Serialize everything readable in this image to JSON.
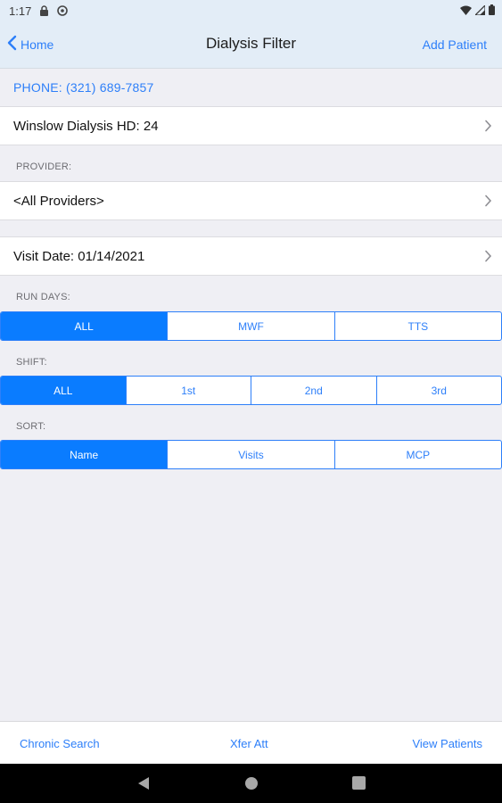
{
  "status": {
    "time": "1:17"
  },
  "nav": {
    "back_label": "Home",
    "title": "Dialysis Filter",
    "add_label": "Add Patient"
  },
  "phone": "PHONE: (321) 689-7857",
  "facility": {
    "label": "Winslow Dialysis HD: 24"
  },
  "provider": {
    "section": "PROVIDER:",
    "value": "<All Providers>"
  },
  "visit": {
    "label": "Visit Date: 01/14/2021"
  },
  "run_days": {
    "section": "RUN DAYS:",
    "options": [
      "ALL",
      "MWF",
      "TTS"
    ],
    "selected": "ALL"
  },
  "shift": {
    "section": "SHIFT:",
    "options": [
      "ALL",
      "1st",
      "2nd",
      "3rd"
    ],
    "selected": "ALL"
  },
  "sort": {
    "section": "SORT:",
    "options": [
      "Name",
      "Visits",
      "MCP"
    ],
    "selected": "Name"
  },
  "bottom_bar": {
    "left": "Chronic Search",
    "center": "Xfer Att",
    "right": "View Patients"
  },
  "colors": {
    "accent": "#2d7ff9",
    "selected": "#0a7cff",
    "background": "#efeff4",
    "header": "#e3edf7"
  },
  "icons": [
    "lock-icon",
    "sync-icon",
    "wifi-icon",
    "signal-icon",
    "battery-icon",
    "chevron-left-icon",
    "chevron-right-icon",
    "android-back-icon",
    "android-home-icon",
    "android-recents-icon"
  ]
}
